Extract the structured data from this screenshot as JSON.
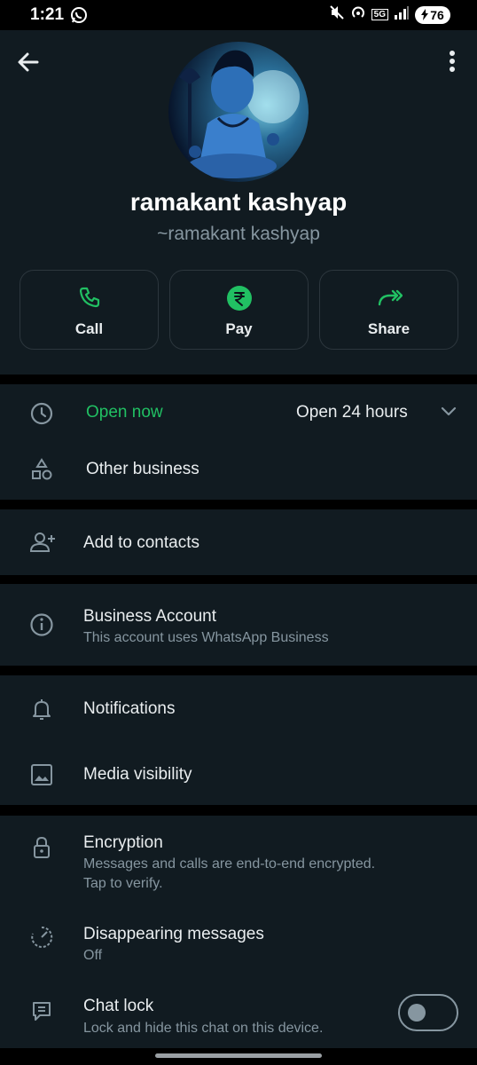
{
  "status_bar": {
    "time": "1:21",
    "battery": "76",
    "network_label": "5G"
  },
  "profile": {
    "name": "ramakant kashyap",
    "subname": "~ramakant kashyap"
  },
  "actions": [
    {
      "label": "Call",
      "icon": "phone-icon"
    },
    {
      "label": "Pay",
      "icon": "rupee-icon"
    },
    {
      "label": "Share",
      "icon": "share-icon"
    }
  ],
  "hours": {
    "status": "Open now",
    "schedule": "Open 24 hours"
  },
  "other_business": {
    "label": "Other business"
  },
  "add_contacts": {
    "label": "Add to contacts"
  },
  "business_account": {
    "title": "Business Account",
    "subtitle": "This account uses WhatsApp Business"
  },
  "notifications": {
    "label": "Notifications"
  },
  "media_visibility": {
    "label": "Media visibility"
  },
  "encryption": {
    "title": "Encryption",
    "subtitle_line1": "Messages and calls are end-to-end encrypted.",
    "subtitle_line2": "Tap to verify."
  },
  "disappearing": {
    "title": "Disappearing messages",
    "subtitle": "Off"
  },
  "chat_lock": {
    "title": "Chat lock",
    "subtitle": "Lock and hide this chat on this device.",
    "enabled": false
  },
  "colors": {
    "background": "#000000",
    "panel": "#111b21",
    "accent_green": "#21c063",
    "text_primary": "#e9edef",
    "text_secondary": "#8696a0"
  }
}
